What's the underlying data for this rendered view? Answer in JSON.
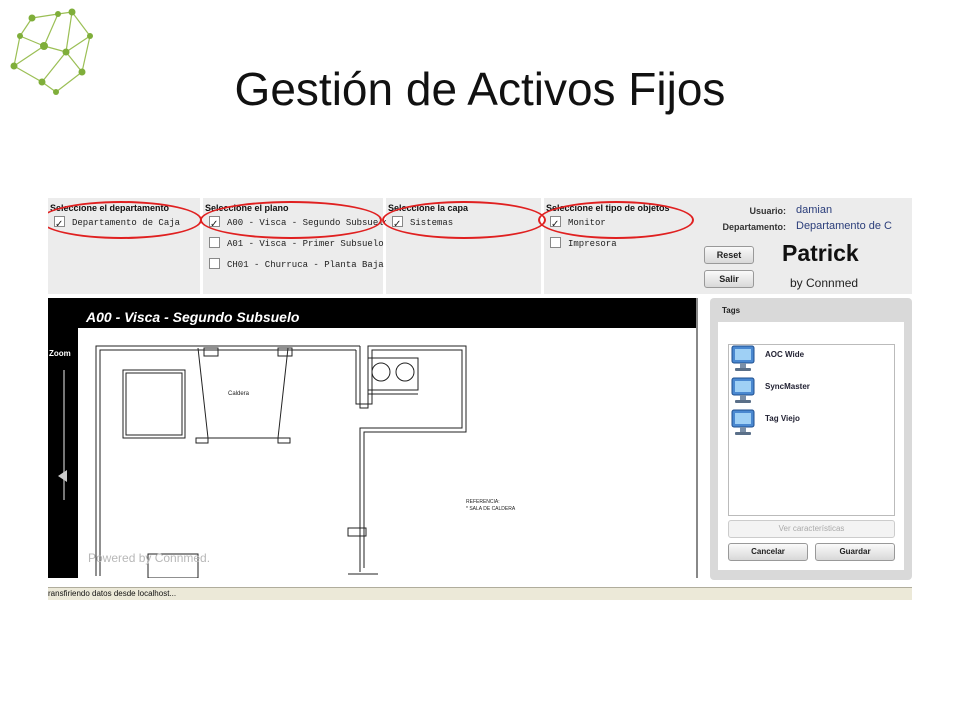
{
  "slide": {
    "title": "Gestión de Activos Fijos"
  },
  "panels": [
    {
      "title": "Seleccione el departamento",
      "options": [
        {
          "label": "Departamento de Caja",
          "checked": true
        }
      ]
    },
    {
      "title": "Seleccione el plano",
      "options": [
        {
          "label": "A00 - Visca - Segundo Subsuelo",
          "checked": true
        },
        {
          "label": "A01 - Visca - Primer Subsuelo",
          "checked": false
        },
        {
          "label": "CH01 - Churruca - Planta Baja",
          "checked": false
        }
      ]
    },
    {
      "title": "Seleccione la capa",
      "options": [
        {
          "label": "Sistemas",
          "checked": true
        }
      ]
    },
    {
      "title": "Seleccione el tipo de objetos",
      "options": [
        {
          "label": "Monitor",
          "checked": true
        },
        {
          "label": "Impresora",
          "checked": false
        }
      ]
    }
  ],
  "user": {
    "usuario_label": "Usuario:",
    "usuario_value": "damian",
    "departamento_label": "Departamento:",
    "departamento_value": "Departamento de C",
    "reset_label": "Reset",
    "salir_label": "Salir",
    "brand": "Patrick",
    "brand_sub": "by Connmed"
  },
  "map": {
    "title": "A00 - Visca - Segundo Subsuelo",
    "zoom_label": "Zoom",
    "room_label": "Caldera",
    "ref_line1": "REFERENCIA:",
    "ref_line2": "* SALA DE CALDERA",
    "watermark": "Powered by Connmed."
  },
  "tags": {
    "title": "Tags",
    "items": [
      "AOC Wide",
      "SyncMaster",
      "Tag Viejo"
    ],
    "details_label": "Ver características",
    "cancel_label": "Cancelar",
    "save_label": "Guardar"
  },
  "status": {
    "text": "ransfiriendo datos desde localhost..."
  },
  "colors": {
    "highlight_oval": "#e02020",
    "map_header": "#000000",
    "panel_bg": "#ececec"
  }
}
